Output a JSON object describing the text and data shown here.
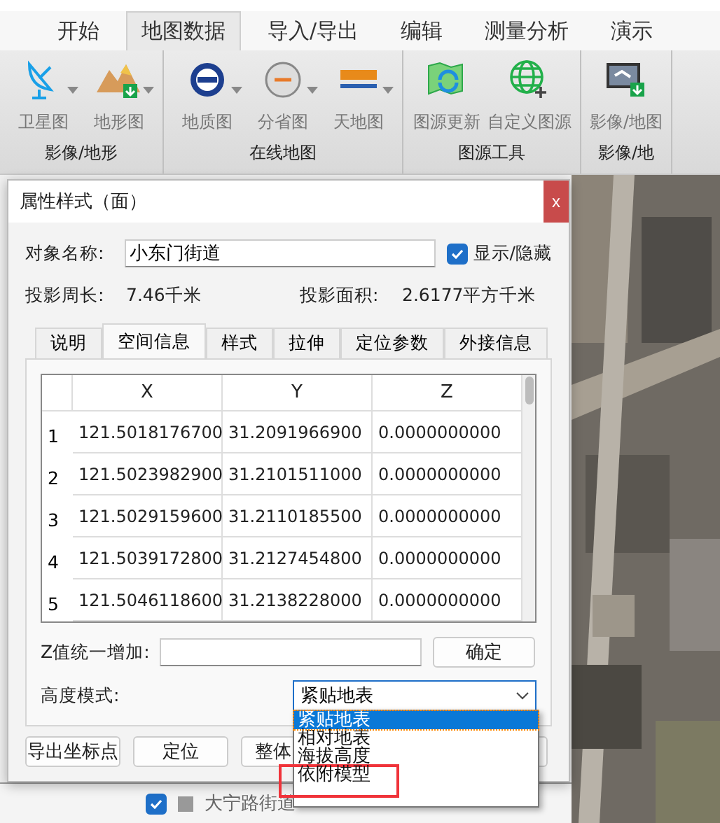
{
  "ribbon": {
    "tabs": [
      {
        "label": "开始",
        "selected": false
      },
      {
        "label": "地图数据",
        "selected": true
      },
      {
        "label": "导入/导出",
        "selected": false
      },
      {
        "label": "编辑",
        "selected": false
      },
      {
        "label": "测量分析",
        "selected": false
      },
      {
        "label": "演示",
        "selected": false
      }
    ],
    "groups": [
      {
        "title": "影像/地形",
        "buttons": [
          {
            "label": "卫星图",
            "kind": "dish",
            "dropdown": true
          },
          {
            "label": "地形图",
            "kind": "mountain",
            "dropdown": true
          }
        ]
      },
      {
        "title": "在线地图",
        "buttons": [
          {
            "label": "地质图",
            "kind": "seal",
            "dropdown": true
          },
          {
            "label": "分省图",
            "kind": "disc",
            "dropdown": true
          },
          {
            "label": "天地图",
            "kind": "banner",
            "dropdown": true
          }
        ]
      },
      {
        "title": "图源工具",
        "buttons": [
          {
            "label": "图源更新",
            "kind": "maprefresh",
            "dropdown": false
          },
          {
            "label": "自定义图源",
            "kind": "globeplus",
            "dropdown": false
          }
        ]
      },
      {
        "title": "影像/地",
        "buttons": [
          {
            "label": "影像/地图",
            "kind": "screen",
            "dropdown": false
          }
        ]
      }
    ]
  },
  "layer_row": {
    "checked": true,
    "label": "大宁路街道"
  },
  "dialog": {
    "title": "属性样式（面）",
    "close": "x",
    "name_label": "对象名称:",
    "name_value": "小东门街道",
    "visible_label": "显示/隐藏",
    "visible": true,
    "perimeter_label": "投影周长:",
    "perimeter": "7.46千米",
    "area_label": "投影面积:",
    "area": "2.6177平方千米",
    "tabs": [
      {
        "label": "说明",
        "selected": false
      },
      {
        "label": "空间信息",
        "selected": true
      },
      {
        "label": "样式",
        "selected": false
      },
      {
        "label": "拉伸",
        "selected": false
      },
      {
        "label": "定位参数",
        "selected": false
      },
      {
        "label": "外接信息",
        "selected": false
      }
    ],
    "table": {
      "columns": [
        "X",
        "Y",
        "Z"
      ],
      "rows": [
        {
          "index": "1",
          "cells": [
            "121.5018176700",
            "31.2091966900",
            "0.0000000000"
          ]
        },
        {
          "index": "2",
          "cells": [
            "121.5023982900",
            "31.2101511000",
            "0.0000000000"
          ]
        },
        {
          "index": "3",
          "cells": [
            "121.5029159600",
            "31.2110185500",
            "0.0000000000"
          ]
        },
        {
          "index": "4",
          "cells": [
            "121.5039172800",
            "31.2127454800",
            "0.0000000000"
          ]
        },
        {
          "index": "5",
          "cells": [
            "121.5046118600",
            "31.2138228000",
            "0.0000000000"
          ]
        }
      ]
    },
    "z_label": "Z值统一增加:",
    "z_button": "确定",
    "height_label": "高度模式:",
    "height_value": "紧贴地表",
    "height_options": [
      {
        "label": "紧贴地表",
        "selected": true,
        "highlighted": false
      },
      {
        "label": "相对地表",
        "selected": false,
        "highlighted": false
      },
      {
        "label": "海拔高度",
        "selected": false,
        "highlighted": false
      },
      {
        "label": "依附模型",
        "selected": false,
        "highlighted": true
      }
    ],
    "buttons": [
      "导出坐标点",
      "定位",
      "整体"
    ]
  }
}
